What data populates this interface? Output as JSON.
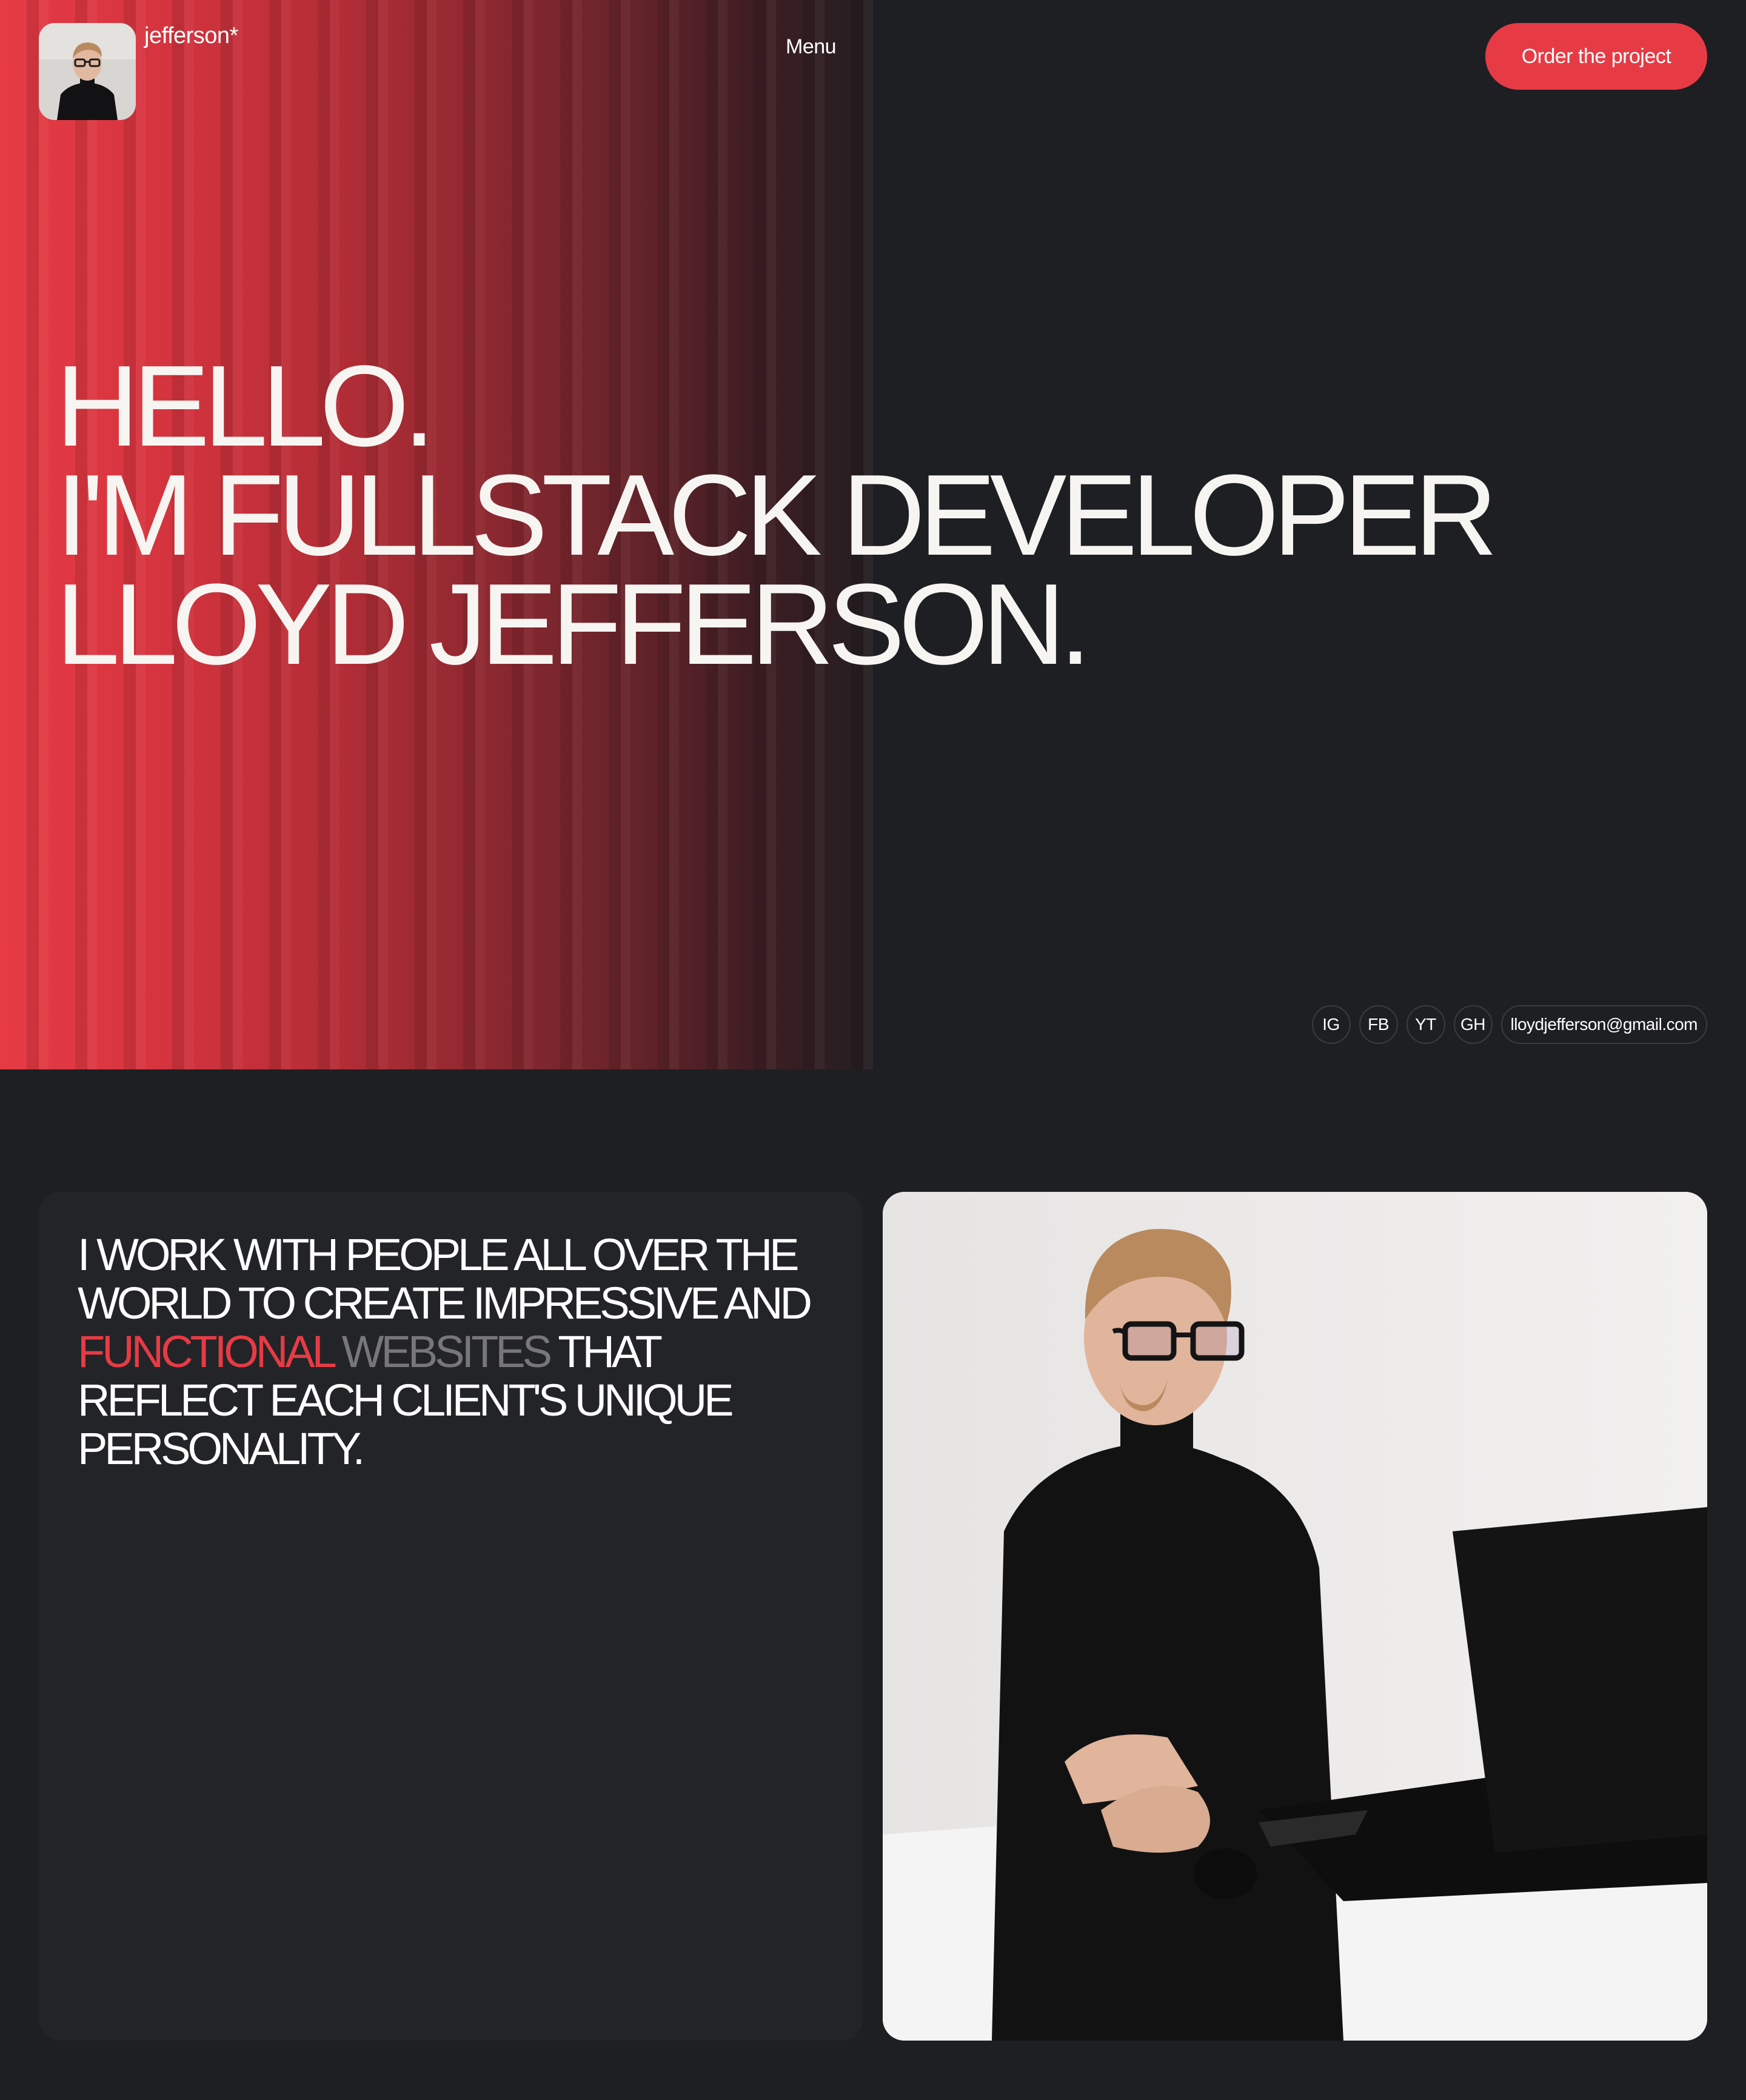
{
  "header": {
    "brand": "jefferson*",
    "menu_label": "Menu",
    "order_label": "Order the project"
  },
  "hero": {
    "line1": "HELLO.",
    "line2": "I'M FULLSTACK DEVELOPER",
    "line3": "LLOYD JEFFERSON."
  },
  "socials": {
    "ig": "IG",
    "fb": "FB",
    "yt": "YT",
    "gh": "GH",
    "email": "lloydjefferson@gmail.com"
  },
  "about": {
    "part1": "I WORK WITH PEOPLE ALL OVER THE WORLD TO CREATE IMPRESSIVE AND ",
    "highlight_red": "FUNCTIONAL",
    "highlight_gray": "WEBSITES",
    "part2": "THAT REFLECT EACH CLIENT'S UNIQUE PERSONALITY."
  },
  "colors": {
    "accent": "#e63b45",
    "background": "#1e1f22",
    "card": "#232427",
    "muted": "#77777b"
  }
}
